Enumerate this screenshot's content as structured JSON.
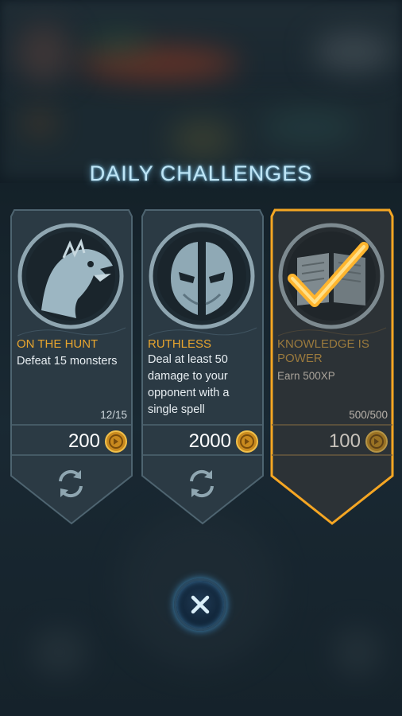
{
  "screen": {
    "title": "DAILY CHALLENGES"
  },
  "challenges": [
    {
      "name": "ON THE HUNT",
      "description": "Defeat 15 monsters",
      "progress": "12/15",
      "reward": "200",
      "emblem": "griffin-head-icon",
      "completed": false
    },
    {
      "name": "RUTHLESS",
      "description": "Deal at least 50 damage to your opponent with a single spell",
      "progress": "",
      "reward": "2000",
      "emblem": "knight-helmet-icon",
      "completed": false
    },
    {
      "name": "KNOWLEDGE IS POWER",
      "description": "Earn  500XP",
      "progress": "500/500",
      "reward": "100",
      "emblem": "open-book-icon",
      "completed": true
    }
  ],
  "icons": {
    "coin": "gold-coin-icon",
    "refresh": "refresh-icon",
    "checkmark": "checkmark-icon",
    "close": "close-icon"
  },
  "colors": {
    "title_glow": "#bfe6f7",
    "challenge_name": "#e8a52e",
    "completed_border": "#f5a623",
    "card_fill": "#2a3a44"
  }
}
